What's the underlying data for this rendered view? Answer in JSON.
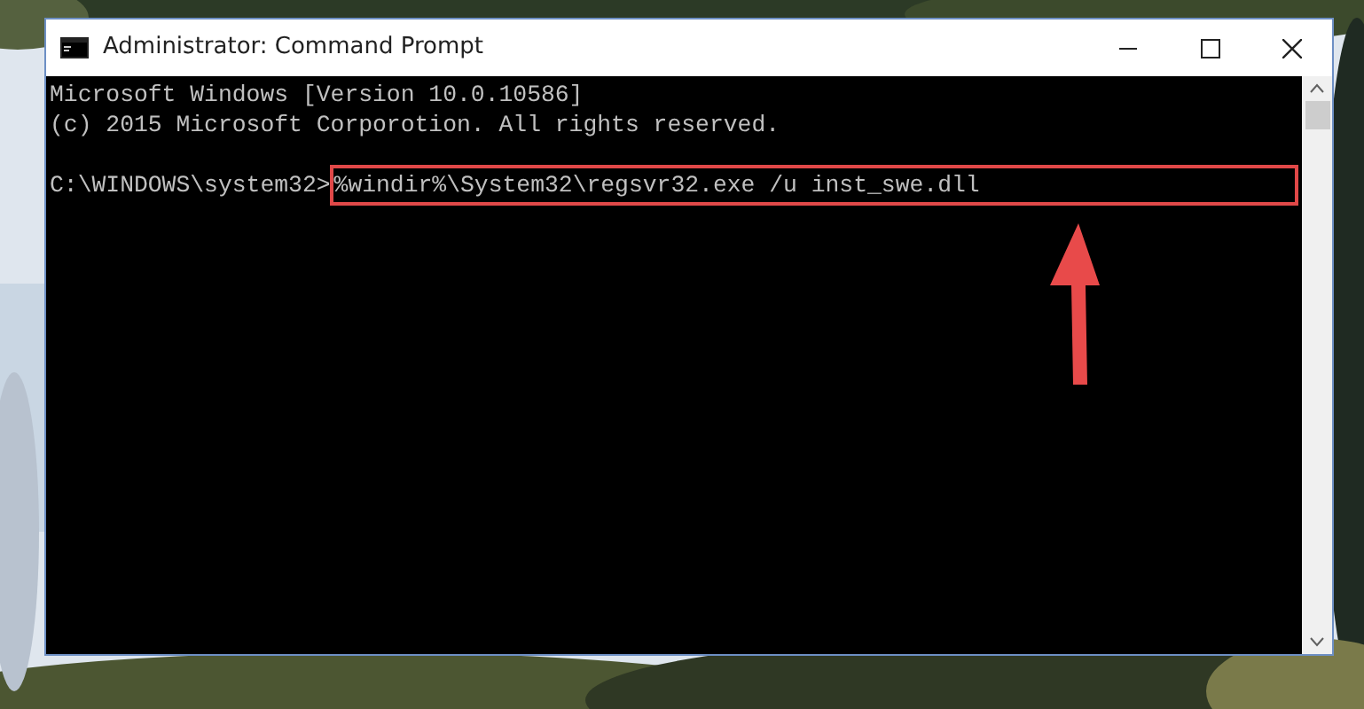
{
  "window": {
    "title": "Administrator: Command Prompt"
  },
  "console": {
    "output_lines": [
      "Microsoft Windows [Version 10.0.10586]",
      "(c) 2015 Microsoft Corporotion. All rights reserved."
    ],
    "prompt": "C:\\WINDOWS\\system32>",
    "command": "%windir%\\System32\\regsvr32.exe /u inst_swe.dll",
    "highlighted": true,
    "callout_arrow": true
  }
}
